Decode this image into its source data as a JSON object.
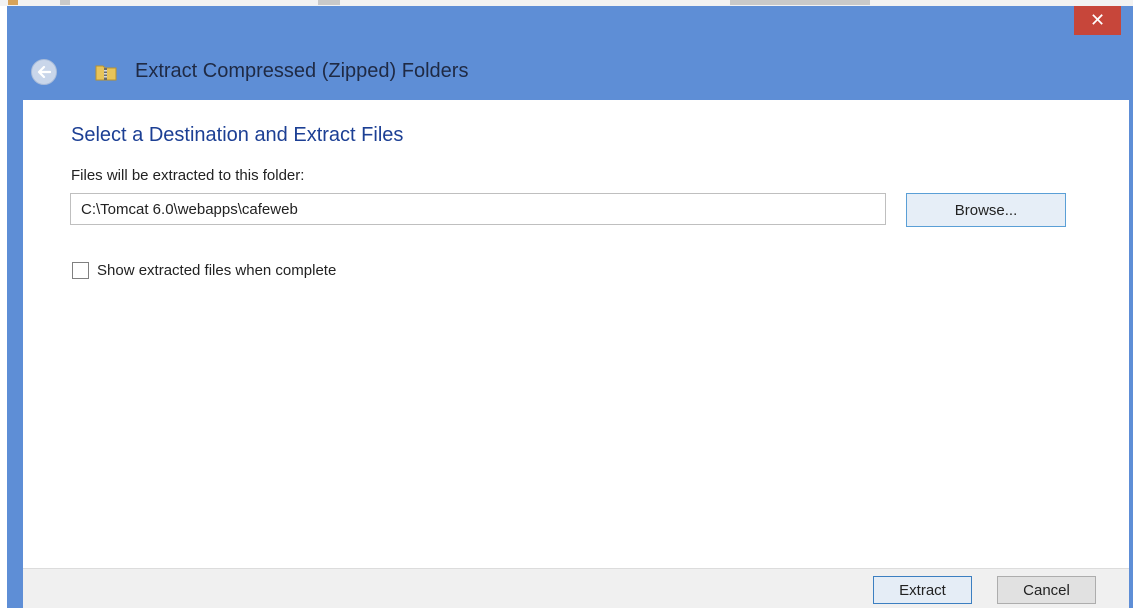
{
  "window": {
    "title": "Extract Compressed (Zipped) Folders",
    "close_glyph": "✕",
    "icons": {
      "back": "back-arrow-icon",
      "folder": "zip-folder-icon",
      "close": "close-icon"
    },
    "colors": {
      "titlebar": "#5e8ed6",
      "close": "#c7463a",
      "heading": "#1c3f94"
    }
  },
  "content": {
    "heading": "Select a Destination and Extract Files",
    "folder_label": "Files will be extracted to this folder:",
    "destination_path": "C:\\Tomcat 6.0\\webapps\\cafeweb",
    "browse_label": "Browse...",
    "show_files_label": "Show extracted files when complete",
    "show_files_checked": false
  },
  "footer": {
    "extract_label": "Extract",
    "cancel_label": "Cancel"
  }
}
